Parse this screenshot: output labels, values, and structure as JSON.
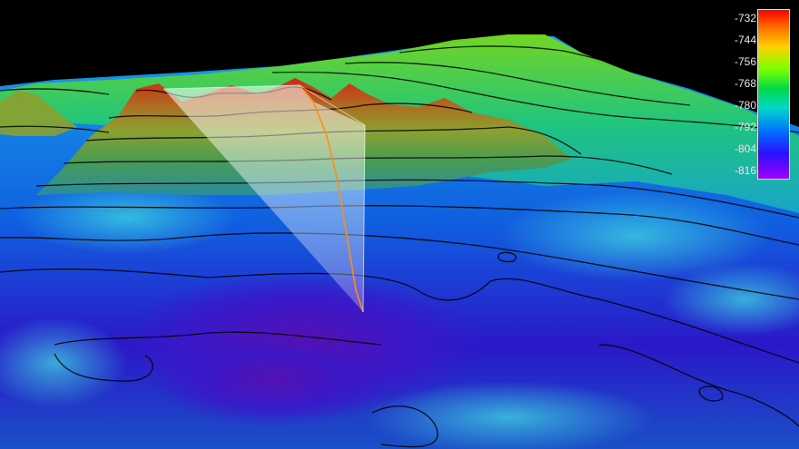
{
  "scene": {
    "type": "3d-bathymetry-terrain-view",
    "contour_color": "#000000",
    "profile_fill_color": "#ffffff",
    "profile_line_color": "#ff8c1a",
    "background": "#000000"
  },
  "colorbar": {
    "labels": [
      "-732",
      "-744",
      "-756",
      "-768",
      "-780",
      "-792",
      "-804",
      "-816"
    ],
    "colors": [
      "#ff0000",
      "#ff8c00",
      "#d8ff00",
      "#38ff00",
      "#00e060",
      "#00c0e0",
      "#1030ff",
      "#a000ff"
    ]
  }
}
